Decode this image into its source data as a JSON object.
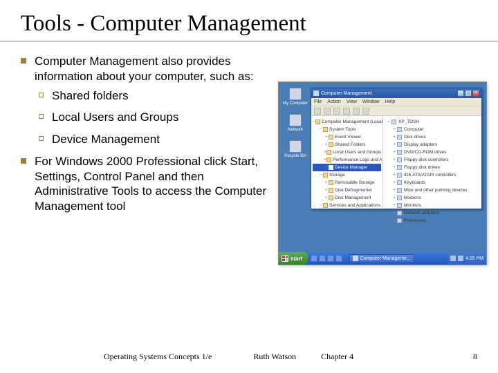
{
  "title": "Tools - Computer Management",
  "bullets": {
    "b1": "Computer Management also provides information about your computer, such as:",
    "sub1": "Shared folders",
    "sub2": "Local Users and Groups",
    "sub3": "Device Management",
    "b2": "For Windows 2000 Professional click Start, Settings, Control Panel and then Administrative Tools to access the Computer Management tool"
  },
  "screenshot": {
    "desktop_icons": [
      "My Computer",
      "Recycle Bin",
      "Network",
      "Recycle Bin"
    ],
    "window": {
      "title": "Computer Management",
      "menus": [
        "File",
        "Action",
        "View",
        "Window",
        "Help"
      ],
      "tree": [
        "Computer Management (Local)",
        "System Tools",
        "Event Viewer",
        "Shared Folders",
        "Local Users and Groups",
        "Performance Logs and Alerts",
        "Device Manager",
        "Storage",
        "Removable Storage",
        "Disk Defragmenter",
        "Disk Management",
        "Services and Applications"
      ],
      "tree_selected_index": 6,
      "list": [
        "XP_TOSH",
        "Computer",
        "Disk drives",
        "Display adapters",
        "DVD/CD-ROM drives",
        "Floppy disk controllers",
        "Floppy disk drives",
        "IDE ATA/ATAPI controllers",
        "Keyboards",
        "Mice and other pointing devices",
        "Modems",
        "Monitors",
        "Network adapters",
        "Processors"
      ]
    },
    "taskbar": {
      "start_label": "start",
      "task_label": "Computer Manageme...",
      "clock": "4:05 PM"
    }
  },
  "footer": {
    "left": "Operating Systems Concepts 1/e",
    "mid": "Ruth Watson",
    "chapter": "Chapter 4",
    "page": "8"
  }
}
